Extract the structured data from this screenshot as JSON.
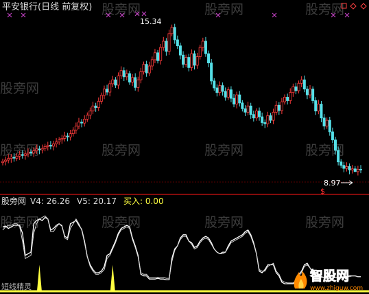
{
  "header": {
    "title": "平安银行(日线 前复权)",
    "title_color": "#dcdcdc",
    "corner_icons": [
      "close-square-icon",
      "diamond-icon",
      "diamond-icon"
    ]
  },
  "watermark": {
    "text": "股旁网"
  },
  "price_panel": {
    "high_label": "15.34",
    "low_label": "8.97",
    "signal_marker": "$",
    "signal_marker_color": "#ff3030"
  },
  "indicator_panel": {
    "legend_name": "股旁网",
    "v4_label": "V4: 26.26",
    "v5_label": "V5: 20.17",
    "buy_label": "买入: 0.00",
    "bottom_text": "短线精灵  ",
    "legend_color": "#dcdcdc",
    "buy_color": "#ffff40"
  },
  "brand": {
    "logo_text": "智股网",
    "url": "www.zhiguw.com"
  },
  "colors": {
    "background": "#000000",
    "up": "#ff3c3c",
    "down": "#55e0e8",
    "cross_marker": "#c040c0",
    "line_white": "#ffffff",
    "line_gray": "#d8d8d8",
    "buy_spike": "#ffff40",
    "separator": "#b01010",
    "gridline": "#5a0000",
    "logo_orange": "#ff8a00"
  },
  "chart_data": [
    {
      "type": "candlestick",
      "title": "平安银行(日线 前复权)",
      "annotations": [
        {
          "text": "15.34",
          "meaning": "period high"
        },
        {
          "text": "8.97",
          "meaning": "period low"
        }
      ],
      "ylim": [
        8.5,
        15.6
      ],
      "close": [
        9.42,
        9.48,
        9.55,
        9.61,
        9.56,
        9.65,
        9.72,
        9.68,
        9.75,
        9.82,
        9.78,
        9.88,
        9.96,
        9.92,
        9.98,
        10.06,
        10.12,
        10.08,
        10.18,
        10.26,
        10.35,
        10.42,
        10.52,
        10.48,
        10.62,
        10.78,
        10.95,
        11.12,
        11.08,
        11.25,
        11.42,
        11.6,
        11.82,
        11.75,
        12.02,
        12.28,
        12.55,
        12.42,
        12.78,
        12.95,
        12.72,
        13.12,
        13.35,
        13.08,
        13.22,
        12.85,
        13.05,
        12.62,
        12.95,
        13.3,
        13.62,
        13.25,
        13.55,
        13.82,
        14.12,
        13.78,
        14.35,
        14.62,
        14.18,
        14.95,
        15.22,
        14.68,
        14.42,
        14.02,
        13.62,
        13.92,
        13.48,
        14.08,
        13.58,
        13.95,
        14.35,
        14.62,
        14.08,
        13.68,
        12.9,
        12.6,
        12.4,
        12.7,
        12.45,
        12.2,
        12.52,
        12.15,
        11.9,
        12.3,
        11.95,
        11.7,
        11.55,
        11.82,
        11.45,
        11.3,
        11.6,
        11.35,
        11.1,
        11.05,
        11.4,
        11.2,
        11.55,
        11.85,
        11.62,
        12.0,
        12.2,
        12.05,
        12.4,
        12.65,
        12.48,
        12.8,
        12.95,
        12.55,
        12.3,
        12.55,
        12.05,
        11.6,
        11.9,
        11.3,
        10.95,
        11.2,
        10.7,
        10.35,
        9.9,
        9.4,
        9.25,
        9.12,
        9.2,
        9.05,
        9.1,
        8.98,
        9.08,
        9.05
      ],
      "high_value": 15.34,
      "low_value": 8.97
    },
    {
      "type": "line",
      "legend": "股旁网  V4: 26.26  V5: 20.17  买入: 0.00",
      "ylim": [
        0,
        100
      ],
      "series": [
        {
          "name": "V4",
          "values": [
            78,
            79,
            76,
            78,
            80,
            80,
            80,
            70,
            42,
            44,
            46,
            82,
            86,
            88,
            86,
            90,
            88,
            74,
            76,
            80,
            82,
            79,
            66,
            64,
            82,
            84,
            86,
            80,
            75,
            60,
            40,
            30,
            24,
            20,
            20,
            22,
            28,
            42,
            44,
            52,
            60,
            70,
            76,
            78,
            80,
            78,
            64,
            54,
            42,
            18,
            16,
            16,
            12,
            12,
            12,
            13,
            12,
            12,
            11,
            11,
            38,
            50,
            54,
            64,
            68,
            68,
            60,
            58,
            52,
            54,
            60,
            64,
            66,
            64,
            58,
            50,
            46,
            44,
            46,
            46,
            54,
            60,
            62,
            64,
            66,
            68,
            72,
            74,
            68,
            58,
            44,
            22,
            20,
            24,
            30,
            30,
            30,
            20,
            16,
            8,
            6,
            6,
            6,
            6,
            10,
            18,
            22,
            30,
            32,
            26,
            20,
            16,
            15,
            15,
            14,
            13,
            13,
            13,
            14,
            14,
            14,
            15,
            15,
            16,
            16,
            16,
            15,
            15
          ]
        },
        {
          "name": "V5",
          "values": [
            74,
            78,
            80,
            80,
            82,
            82,
            78,
            60,
            38,
            40,
            42,
            70,
            82,
            88,
            90,
            92,
            88,
            72,
            72,
            78,
            82,
            80,
            64,
            62,
            76,
            82,
            88,
            82,
            74,
            58,
            40,
            28,
            22,
            18,
            18,
            20,
            24,
            38,
            42,
            50,
            58,
            68,
            74,
            76,
            78,
            76,
            62,
            52,
            40,
            20,
            18,
            18,
            14,
            14,
            14,
            14,
            14,
            14,
            13,
            13,
            34,
            48,
            54,
            62,
            66,
            66,
            60,
            56,
            50,
            52,
            58,
            62,
            64,
            62,
            56,
            50,
            46,
            44,
            44,
            46,
            52,
            58,
            60,
            62,
            64,
            66,
            70,
            72,
            66,
            56,
            44,
            24,
            22,
            22,
            28,
            30,
            32,
            22,
            18,
            10,
            8,
            7,
            7,
            7,
            10,
            16,
            20,
            28,
            30,
            26,
            20,
            16,
            15,
            14,
            14,
            13,
            13,
            13,
            14,
            14,
            14,
            15,
            15,
            15,
            16,
            16,
            15,
            15
          ]
        },
        {
          "name": "买入",
          "values": [
            0,
            0,
            0,
            0,
            0,
            0,
            0,
            0,
            0,
            0,
            0,
            0,
            0,
            30,
            0,
            0,
            0,
            0,
            0,
            0,
            0,
            0,
            0,
            0,
            0,
            0,
            0,
            0,
            0,
            0,
            0,
            0,
            0,
            0,
            0,
            0,
            0,
            0,
            0,
            30,
            0,
            0,
            0,
            0,
            0,
            0,
            0,
            0,
            0,
            0,
            0,
            0,
            0,
            0,
            0,
            0,
            0,
            0,
            0,
            0,
            0,
            0,
            0,
            0,
            0,
            0,
            0,
            0,
            0,
            0,
            0,
            0,
            0,
            0,
            0,
            0,
            0,
            0,
            0,
            0,
            0,
            0,
            0,
            0,
            0,
            0,
            0,
            0,
            0,
            0,
            0,
            0,
            0,
            0,
            0,
            0,
            0,
            0,
            0,
            0,
            0,
            0,
            0,
            0,
            0,
            0,
            0,
            0,
            0,
            0,
            0,
            0,
            0,
            0,
            0,
            0,
            0,
            0,
            0,
            0,
            0,
            0,
            0,
            0,
            0,
            0,
            0,
            0
          ]
        }
      ]
    }
  ]
}
